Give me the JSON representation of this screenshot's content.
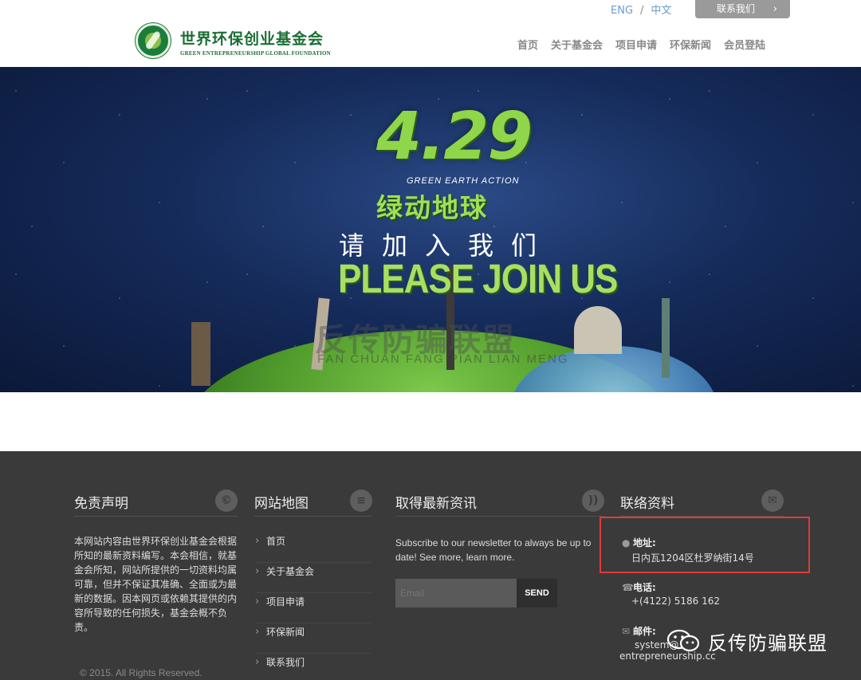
{
  "header": {
    "lang_en": "ENG",
    "lang_sep": "/",
    "lang_cn": "中文",
    "contact_button": "联系我们",
    "contact_chevron": "›",
    "brand_cn": "世界环保创业基金会",
    "brand_en": "GREEN ENTREPRENEURSHIP GLOBAL FOUNDATION",
    "nav": [
      "首页",
      "关于基金会",
      "项目申请",
      "环保新闻",
      "会员登陆"
    ]
  },
  "banner": {
    "date": "4.29",
    "tagline": "GREEN EARTH ACTION",
    "title_cn": "绿动地球",
    "invite_cn": "请加入我们",
    "invite_en": "PLEASE JOIN US",
    "watermark_cn": "反传防骗联盟",
    "watermark_en": "FAN CHUAN FANG PIAN LIAN MENG"
  },
  "footer": {
    "disclaimer_title": "免责声明",
    "disclaimer_icon": "copyright-icon",
    "disclaimer_text": "本网站内容由世界环保创业基金会根据所知的最新资料编写。本会相信，就基金会所知，网站所提供的一切资料均属可靠，但并不保证其准确、全面或为最新的数据。因本网页或依赖其提供的内容所导致的任何损失，基金会概不负责。",
    "copyright": "© 2015. All Rights Reserved.",
    "sitemap_title": "网站地图",
    "sitemap_icon": "list-icon",
    "sitemap": [
      "首页",
      "关于基金会",
      "项目申请",
      "环保新闻",
      "联系我们"
    ],
    "news_title": "取得最新资讯",
    "news_icon": "rss-icon",
    "news_text": "Subscribe to our newsletter to always be up to date! See more, learn more.",
    "email_placeholder": "Email",
    "send_label": "SEND",
    "contact_title": "联络资料",
    "contact_icon": "envelope-icon",
    "address_label": "地址:",
    "address_value": "日内瓦1204区杜罗纳街14号",
    "phone_label": "电话:",
    "phone_value": "+(4122) 5186 162",
    "mail_label": "邮件:",
    "mail_value_1": "system@",
    "mail_value_2": "entrepreneurship.cc",
    "highlight_color": "#e03a3a"
  },
  "overlay": {
    "wechat_text": "反传防骗联盟"
  }
}
